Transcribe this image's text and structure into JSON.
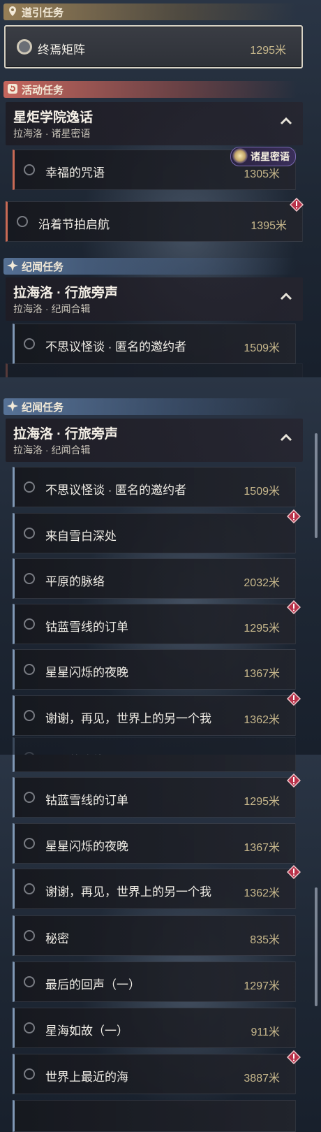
{
  "sections": {
    "guide": "道引任务",
    "event": "活动任务",
    "story": "纪闻任务"
  },
  "guide_task": {
    "name": "终焉矩阵",
    "distance": "1295米"
  },
  "event_group": {
    "title": "星炬学院逸话",
    "subtitle": "拉海洛 · 诸星密语",
    "badge": "诸星密语"
  },
  "event_tasks": [
    {
      "name": "幸福的咒语",
      "distance": "1305米"
    },
    {
      "name": "沿着节拍启航",
      "distance": "1395米"
    }
  ],
  "story_group": {
    "title": "拉海洛 · 行旅旁声",
    "subtitle": "拉海洛 · 纪闻合辑"
  },
  "story_tasks": [
    {
      "name": "不思议怪谈 · 匿名的邀约者",
      "distance": "1509米"
    },
    {
      "name": "来自雪白深处",
      "distance": ""
    },
    {
      "name": "平原的脉络",
      "distance": "2032米"
    },
    {
      "name": "钴蓝雪线的订单",
      "distance": "1295米"
    },
    {
      "name": "星星闪烁的夜晚",
      "distance": "1367米"
    },
    {
      "name": "谢谢，再见，世界上的另一个我",
      "distance": "1362米"
    },
    {
      "name": "秘密",
      "distance": "835米"
    },
    {
      "name": "最后的回声（一）",
      "distance": "1297米"
    },
    {
      "name": "星海如故（一）",
      "distance": "911米"
    },
    {
      "name": "世界上最近的海",
      "distance": "3887米"
    }
  ],
  "icons": {
    "guide": "location-pin-icon",
    "event": "event-refresh-icon",
    "story": "sparkle-icon",
    "collapse": "chevron-up-icon",
    "alert": "alert-diamond-icon"
  },
  "colors": {
    "event_accent": "#c96a55",
    "story_accent": "#7f97b4",
    "distance": "#c9b98d"
  }
}
